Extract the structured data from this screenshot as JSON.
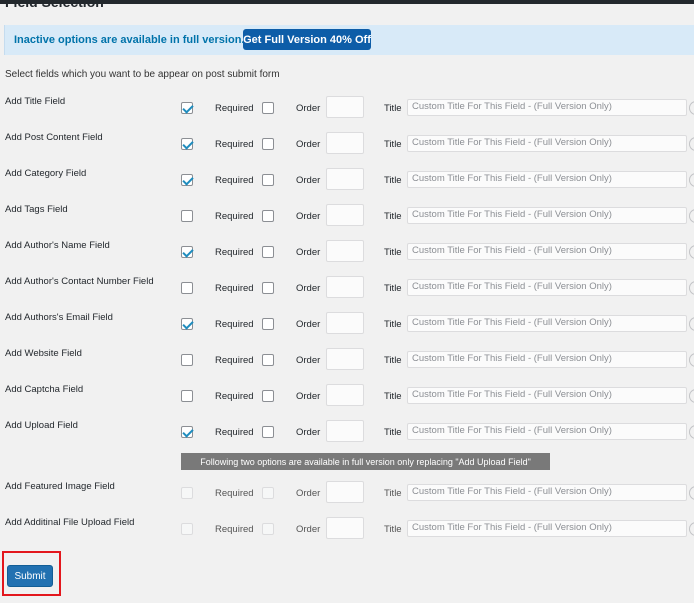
{
  "section": {
    "title": "Field Selection"
  },
  "notice": {
    "text": "Inactive options are available in full version.",
    "button": "Get Full Version 40% Off"
  },
  "intro": "Select fields which you want to be appear on post submit form",
  "labels": {
    "required": "Required",
    "order": "Order",
    "title": "Title"
  },
  "title_placeholder": "Custom Title For This Field - (Full Version Only)",
  "fields": [
    {
      "label": "Add Title Field",
      "checked": true,
      "disabled": false
    },
    {
      "label": "Add Post Content Field",
      "checked": true,
      "disabled": false
    },
    {
      "label": "Add Category Field",
      "checked": true,
      "disabled": false
    },
    {
      "label": "Add Tags Field",
      "checked": false,
      "disabled": false
    },
    {
      "label": "Add Author's Name Field",
      "checked": true,
      "disabled": false
    },
    {
      "label": "Add Author's Contact Number Field",
      "checked": false,
      "disabled": false
    },
    {
      "label": "Add Authors's Email Field",
      "checked": true,
      "disabled": false
    },
    {
      "label": "Add Website Field",
      "checked": false,
      "disabled": false
    },
    {
      "label": "Add Captcha Field",
      "checked": false,
      "disabled": false
    },
    {
      "label": "Add Upload Field",
      "checked": true,
      "disabled": false
    },
    {
      "label": "Add Featured Image Field",
      "checked": false,
      "disabled": true
    },
    {
      "label": "Add Additinal File Upload Field",
      "checked": false,
      "disabled": true
    }
  ],
  "upgrade_note": "Following two options are available in full version only replacing \"Add Upload Field\"",
  "submit": "Submit",
  "colors": {
    "accent": "#2271b1",
    "notice_bg": "#d8eaf8",
    "highlight": "#e3171d"
  }
}
